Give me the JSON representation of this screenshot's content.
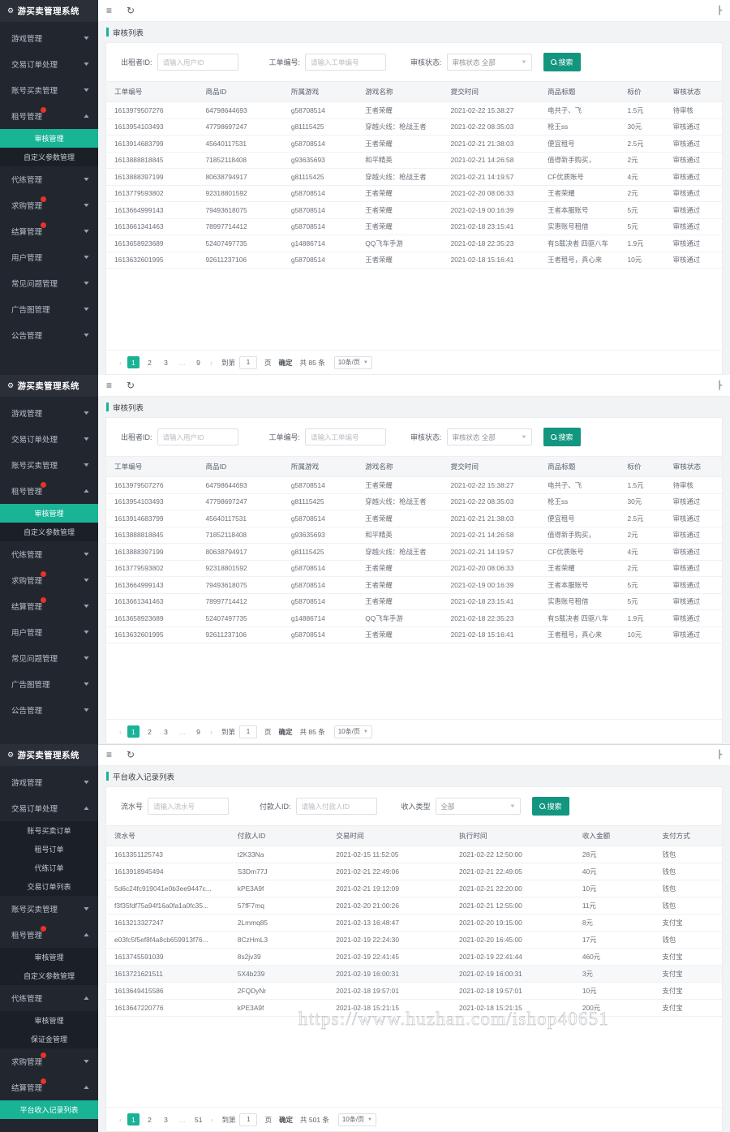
{
  "app": {
    "brand": "游买卖管理系统",
    "gear_icon": "gear-icon",
    "menu_icon": "hamburger-icon",
    "refresh_icon": "refresh-icon",
    "fullscreen_icon": "expand-icon"
  },
  "watermark": "https://www.huzhan.com/ishop40651",
  "colors": {
    "accent": "#19b396",
    "button": "#13967f",
    "sidebar": "#22262e",
    "sidebar_sub": "#1b1f26",
    "badge": "#e8322c"
  },
  "panel1": {
    "breadcrumb": "审核列表",
    "sidebar": [
      {
        "label": "游戏管理",
        "type": "group",
        "badge": false,
        "expanded": false
      },
      {
        "label": "交易订单处理",
        "type": "group",
        "badge": false,
        "expanded": false
      },
      {
        "label": "账号买卖管理",
        "type": "group",
        "badge": false,
        "expanded": false
      },
      {
        "label": "租号管理",
        "type": "group",
        "badge": true,
        "expanded": true
      },
      {
        "label": "审核管理",
        "type": "sub",
        "active": true
      },
      {
        "label": "自定义参数管理",
        "type": "sub",
        "active": false
      },
      {
        "label": "代练管理",
        "type": "group",
        "badge": false,
        "expanded": false
      },
      {
        "label": "求购管理",
        "type": "group",
        "badge": true,
        "expanded": false
      },
      {
        "label": "结算管理",
        "type": "group",
        "badge": true,
        "expanded": false
      },
      {
        "label": "用户管理",
        "type": "group",
        "badge": false,
        "expanded": false
      },
      {
        "label": "常见问题管理",
        "type": "group",
        "badge": false,
        "expanded": false
      },
      {
        "label": "广告图管理",
        "type": "group",
        "badge": false,
        "expanded": false
      },
      {
        "label": "公告管理",
        "type": "group",
        "badge": false,
        "expanded": false
      }
    ],
    "filters": {
      "f1_label": "出租者ID:",
      "f1_placeholder": "请输入用户ID",
      "f2_label": "工单编号:",
      "f2_placeholder": "请输入工单编号",
      "f3_label": "审核状态:",
      "f3_value": "审核状态 全部",
      "search_label": "搜索"
    },
    "columns": [
      "工单编号",
      "商品ID",
      "所属游戏",
      "游戏名称",
      "提交时间",
      "商品标题",
      "标价",
      "审核状态"
    ],
    "rows": [
      [
        "1613979507276",
        "64798644693",
        "g58708514",
        "王者荣耀",
        "2021-02-22 15:38:27",
        "电共子、飞",
        "1.5元",
        "待审核"
      ],
      [
        "1613954103493",
        "47798697247",
        "g81115425",
        "穿越火线：枪战王者",
        "2021-02-22 08:35:03",
        "枪王ss",
        "30元",
        "审核通过"
      ],
      [
        "1613914683799",
        "45640117531",
        "g58708514",
        "王者荣耀",
        "2021-02-21 21:38:03",
        "便宜租号",
        "2.5元",
        "审核通过"
      ],
      [
        "1613888818845",
        "71852118408",
        "g93635693",
        "和平精英",
        "2021-02-21 14:26:58",
        "值得新手购买，",
        "2元",
        "审核通过"
      ],
      [
        "1613888397199",
        "80638794917",
        "g81115425",
        "穿越火线：枪战王者",
        "2021-02-21 14:19:57",
        "CF优质账号",
        "4元",
        "审核通过"
      ],
      [
        "1613779593802",
        "92318801592",
        "g58708514",
        "王者荣耀",
        "2021-02-20 08:06:33",
        "王者荣耀",
        "2元",
        "审核通过"
      ],
      [
        "1613664999143",
        "79493618075",
        "g58708514",
        "王者荣耀",
        "2021-02-19 00:16:39",
        "王者本服账号",
        "5元",
        "审核通过"
      ],
      [
        "1613661341463",
        "78997714412",
        "g58708514",
        "王者荣耀",
        "2021-02-18 23:15:41",
        "实惠账号租借",
        "5元",
        "审核通过"
      ],
      [
        "1613658923689",
        "52407497735",
        "g14886714",
        "QQ飞车手游",
        "2021-02-18 22:35:23",
        "有S载决者 四驱八车",
        "1.9元",
        "审核通过"
      ],
      [
        "1613632601995",
        "92611237106",
        "g58708514",
        "王者荣耀",
        "2021-02-18 15:16:41",
        "王者租号，真心来",
        "10元",
        "审核通过"
      ]
    ],
    "pager": {
      "pages": [
        "1",
        "2",
        "3",
        "…",
        "9"
      ],
      "current": "1",
      "goto_label": "到第",
      "goto_value": "1",
      "page_unit": "页",
      "confirm": "确定",
      "total": "共 85 条",
      "page_size": "10条/页"
    }
  },
  "panel2": {
    "breadcrumb": "审核列表",
    "sidebar": [
      {
        "label": "游戏管理",
        "type": "group",
        "badge": false,
        "expanded": false
      },
      {
        "label": "交易订单处理",
        "type": "group",
        "badge": false,
        "expanded": false
      },
      {
        "label": "账号买卖管理",
        "type": "group",
        "badge": false,
        "expanded": false
      },
      {
        "label": "租号管理",
        "type": "group",
        "badge": true,
        "expanded": true
      },
      {
        "label": "审核管理",
        "type": "sub",
        "active": true
      },
      {
        "label": "自定义参数管理",
        "type": "sub",
        "active": false
      },
      {
        "label": "代练管理",
        "type": "group",
        "badge": false,
        "expanded": false
      },
      {
        "label": "求购管理",
        "type": "group",
        "badge": true,
        "expanded": false
      },
      {
        "label": "结算管理",
        "type": "group",
        "badge": true,
        "expanded": false
      },
      {
        "label": "用户管理",
        "type": "group",
        "badge": false,
        "expanded": false
      },
      {
        "label": "常见问题管理",
        "type": "group",
        "badge": false,
        "expanded": false
      },
      {
        "label": "广告图管理",
        "type": "group",
        "badge": false,
        "expanded": false
      },
      {
        "label": "公告管理",
        "type": "group",
        "badge": false,
        "expanded": false
      }
    ],
    "filters": {
      "f1_label": "出租者ID:",
      "f1_placeholder": "请输入用户ID",
      "f2_label": "工单编号:",
      "f2_placeholder": "请输入工单编号",
      "f3_label": "审核状态:",
      "f3_value": "审核状态 全部",
      "search_label": "搜索"
    },
    "columns": [
      "工单编号",
      "商品ID",
      "所属游戏",
      "游戏名称",
      "提交时间",
      "商品标题",
      "标价",
      "审核状态"
    ],
    "rows": [
      [
        "1613979507276",
        "64798644693",
        "g58708514",
        "王者荣耀",
        "2021-02-22 15:38:27",
        "电共子、飞",
        "1.5元",
        "待审核"
      ],
      [
        "1613954103493",
        "47798697247",
        "g81115425",
        "穿越火线：枪战王者",
        "2021-02-22 08:35:03",
        "枪王ss",
        "30元",
        "审核通过"
      ],
      [
        "1613914683799",
        "45640117531",
        "g58708514",
        "王者荣耀",
        "2021-02-21 21:38:03",
        "便宜租号",
        "2.5元",
        "审核通过"
      ],
      [
        "1613888818845",
        "71852118408",
        "g93635693",
        "和平精英",
        "2021-02-21 14:26:58",
        "值得新手购买，",
        "2元",
        "审核通过"
      ],
      [
        "1613888397199",
        "80638794917",
        "g81115425",
        "穿越火线：枪战王者",
        "2021-02-21 14:19:57",
        "CF优质账号",
        "4元",
        "审核通过"
      ],
      [
        "1613779593802",
        "92318801592",
        "g58708514",
        "王者荣耀",
        "2021-02-20 08:06:33",
        "王者荣耀",
        "2元",
        "审核通过"
      ],
      [
        "1613664999143",
        "79493618075",
        "g58708514",
        "王者荣耀",
        "2021-02-19 00:16:39",
        "王者本服账号",
        "5元",
        "审核通过"
      ],
      [
        "1613661341463",
        "78997714412",
        "g58708514",
        "王者荣耀",
        "2021-02-18 23:15:41",
        "实惠账号租借",
        "5元",
        "审核通过"
      ],
      [
        "1613658923689",
        "52407497735",
        "g14886714",
        "QQ飞车手游",
        "2021-02-18 22:35:23",
        "有S载决者 四驱八车",
        "1.9元",
        "审核通过"
      ],
      [
        "1613632601995",
        "92611237106",
        "g58708514",
        "王者荣耀",
        "2021-02-18 15:16:41",
        "王者租号，真心来",
        "10元",
        "审核通过"
      ]
    ],
    "pager": {
      "pages": [
        "1",
        "2",
        "3",
        "…",
        "9"
      ],
      "current": "1",
      "goto_label": "到第",
      "goto_value": "1",
      "page_unit": "页",
      "confirm": "确定",
      "total": "共 85 条",
      "page_size": "10条/页"
    }
  },
  "panel3": {
    "breadcrumb": "平台收入记录列表",
    "sidebar": [
      {
        "label": "游戏管理",
        "type": "group",
        "badge": false,
        "expanded": false
      },
      {
        "label": "交易订单处理",
        "type": "group",
        "badge": false,
        "expanded": true
      },
      {
        "label": "账号买卖订单",
        "type": "sub",
        "active": false
      },
      {
        "label": "租号订单",
        "type": "sub",
        "active": false
      },
      {
        "label": "代练订单",
        "type": "sub",
        "active": false
      },
      {
        "label": "交易订单列表",
        "type": "sub",
        "active": false
      },
      {
        "label": "账号买卖管理",
        "type": "group",
        "badge": false,
        "expanded": false
      },
      {
        "label": "租号管理",
        "type": "group",
        "badge": true,
        "expanded": true
      },
      {
        "label": "审核管理",
        "type": "sub",
        "active": false
      },
      {
        "label": "自定义参数管理",
        "type": "sub",
        "active": false
      },
      {
        "label": "代练管理",
        "type": "group",
        "badge": false,
        "expanded": true
      },
      {
        "label": "审核管理",
        "type": "sub",
        "active": false
      },
      {
        "label": "保证金管理",
        "type": "sub",
        "active": false
      },
      {
        "label": "求购管理",
        "type": "group",
        "badge": true,
        "expanded": false
      },
      {
        "label": "结算管理",
        "type": "group",
        "badge": true,
        "expanded": true
      },
      {
        "label": "平台收入记录列表",
        "type": "sub",
        "active": true
      }
    ],
    "filters": {
      "f1_label": "流水号",
      "f1_placeholder": "请输入流水号",
      "f2_label": "付款人ID:",
      "f2_placeholder": "请输入付款人ID",
      "f3_label": "收入类型",
      "f3_value": "全部",
      "search_label": "搜索"
    },
    "columns": [
      "流水号",
      "付款人ID",
      "交易时间",
      "执行时间",
      "收入金额",
      "支付方式"
    ],
    "rows": [
      [
        "1613351125743",
        "t2K33Na",
        "2021-02-15 11:52:05",
        "2021-02-22 12:50:00",
        "28元",
        "钱包"
      ],
      [
        "1613918945494",
        "S3Dm77J",
        "2021-02-21 22:49:06",
        "2021-02-21 22:49:05",
        "40元",
        "钱包"
      ],
      [
        "5d6c24fc919041e0b3ee9447c...",
        "kPE3A9f",
        "2021-02-21 19:12:09",
        "2021-02-21 22:20:00",
        "10元",
        "钱包"
      ],
      [
        "f3f35fdf75a94f16a0fa1a0fc35...",
        "57fF7mq",
        "2021-02-20 21:00:26",
        "2021-02-21 12:55:00",
        "11元",
        "钱包"
      ],
      [
        "1613213327247",
        "2Lmmq85",
        "2021-02-13 16:48:47",
        "2021-02-20 19:15:00",
        "8元",
        "支付宝"
      ],
      [
        "e03fc5f5ef8f4a8cb659913f76...",
        "8CzHmL3",
        "2021-02-19 22:24:30",
        "2021-02-20 16:45:00",
        "17元",
        "钱包"
      ],
      [
        "1613745591039",
        "8s2jv39",
        "2021-02-19 22:41:45",
        "2021-02-19 22:41:44",
        "460元",
        "支付宝"
      ],
      [
        "1613721621511",
        "5X4b239",
        "2021-02-19 16:00:31",
        "2021-02-19 16:00:31",
        "3元",
        "支付宝"
      ],
      [
        "1613649415586",
        "2FQDyNr",
        "2021-02-18 19:57:01",
        "2021-02-18 19:57:01",
        "10元",
        "支付宝"
      ],
      [
        "1613647220776",
        "kPE3A9f",
        "2021-02-18 15:21:15",
        "2021-02-18 15:21:15",
        "200元",
        "支付宝"
      ]
    ],
    "pager": {
      "pages": [
        "1",
        "2",
        "3",
        "…",
        "51"
      ],
      "current": "1",
      "goto_label": "到第",
      "goto_value": "1",
      "page_unit": "页",
      "confirm": "确定",
      "total": "共 501 条",
      "page_size": "10条/页"
    }
  }
}
